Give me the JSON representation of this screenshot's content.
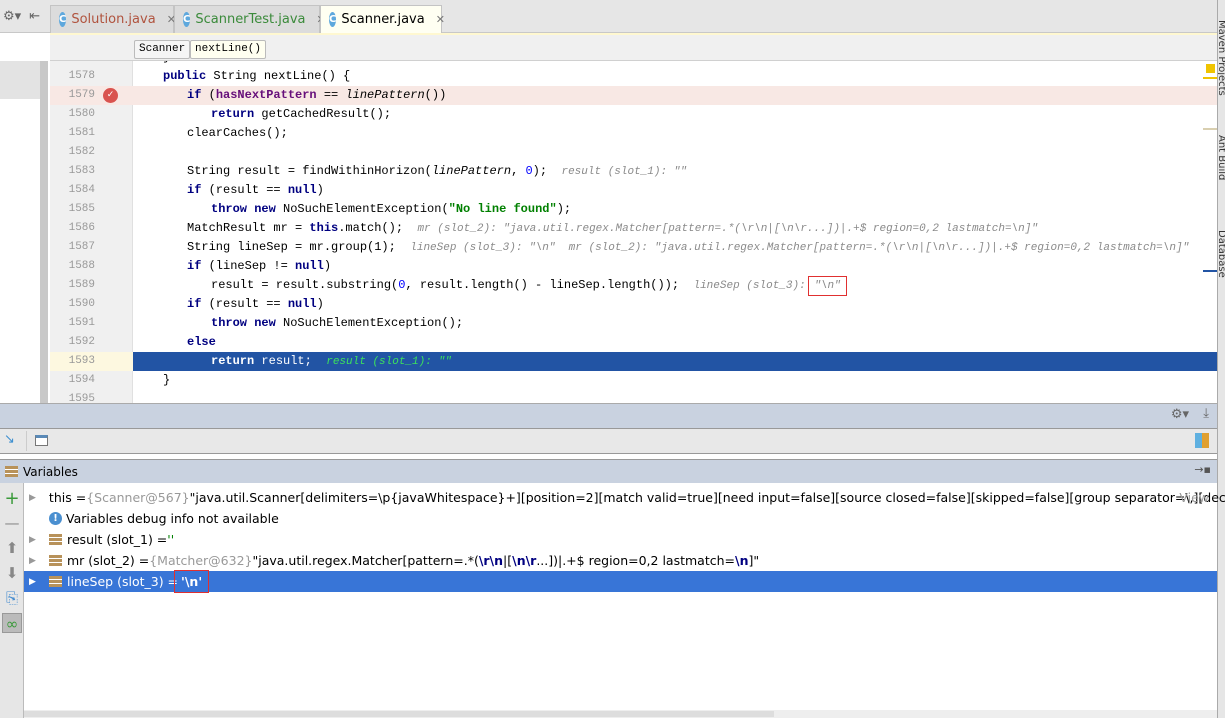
{
  "tabs": [
    {
      "label": "Solution.java",
      "color": "#b0533e",
      "active": false
    },
    {
      "label": "ScannerTest.java",
      "color": "#3a8a3a",
      "active": false
    },
    {
      "label": "Scanner.java",
      "color": "#000000",
      "active": true
    }
  ],
  "breadcrumbs": [
    "Scanner",
    "nextLine()"
  ],
  "editor": {
    "lines": [
      {
        "n": "1577",
        "indent": 1,
        "tokens": [
          {
            "t": "}",
            "c": ""
          }
        ]
      },
      {
        "n": "1578",
        "indent": 1,
        "tokens": [
          {
            "t": "public",
            "c": "kw"
          },
          {
            "t": " String nextLine() {",
            "c": ""
          }
        ]
      },
      {
        "n": "1579",
        "indent": 2,
        "state": "breakpoint",
        "tokens": [
          {
            "t": "if",
            "c": "kw"
          },
          {
            "t": " (",
            "c": ""
          },
          {
            "t": "hasNextPattern",
            "c": "fld"
          },
          {
            "t": " == ",
            "c": ""
          },
          {
            "t": "linePattern",
            "c": "it"
          },
          {
            "t": "())",
            "c": ""
          }
        ]
      },
      {
        "n": "1580",
        "indent": 3,
        "tokens": [
          {
            "t": "return",
            "c": "kw"
          },
          {
            "t": " getCachedResult();",
            "c": ""
          }
        ]
      },
      {
        "n": "1581",
        "indent": 2,
        "tokens": [
          {
            "t": "clearCaches();",
            "c": ""
          }
        ]
      },
      {
        "n": "1582",
        "indent": 2,
        "tokens": []
      },
      {
        "n": "1583",
        "indent": 2,
        "tokens": [
          {
            "t": "String result = findWithinHorizon(",
            "c": ""
          },
          {
            "t": "linePattern",
            "c": "it"
          },
          {
            "t": ", ",
            "c": ""
          },
          {
            "t": "0",
            "c": "numl"
          },
          {
            "t": ");  ",
            "c": ""
          },
          {
            "t": "result (slot_1): \"\"",
            "c": "hint"
          }
        ]
      },
      {
        "n": "1584",
        "indent": 2,
        "tokens": [
          {
            "t": "if",
            "c": "kw"
          },
          {
            "t": " (result == ",
            "c": ""
          },
          {
            "t": "null",
            "c": "kw"
          },
          {
            "t": ")",
            "c": ""
          }
        ]
      },
      {
        "n": "1585",
        "indent": 3,
        "tokens": [
          {
            "t": "throw",
            "c": "kw"
          },
          {
            "t": " ",
            "c": ""
          },
          {
            "t": "new",
            "c": "kw"
          },
          {
            "t": " NoSuchElementException(",
            "c": ""
          },
          {
            "t": "\"No line found\"",
            "c": "str"
          },
          {
            "t": ");",
            "c": ""
          }
        ]
      },
      {
        "n": "1586",
        "indent": 2,
        "tokens": [
          {
            "t": "MatchResult mr = ",
            "c": ""
          },
          {
            "t": "this",
            "c": "kw"
          },
          {
            "t": ".match();  ",
            "c": ""
          },
          {
            "t": "mr (slot_2): \"java.util.regex.Matcher[pattern=.*(\\r\\n|[\\n\\r...])|.+$ region=0,2 lastmatch=\\n]\"",
            "c": "hint"
          }
        ]
      },
      {
        "n": "1587",
        "indent": 2,
        "tokens": [
          {
            "t": "String lineSep = mr.group(1);  ",
            "c": ""
          },
          {
            "t": "lineSep (slot_3): \"\\n\"  mr (slot_2): \"java.util.regex.Matcher[pattern=.*(\\r\\n|[\\n\\r...])|.+$ region=0,2 lastmatch=\\n]\"",
            "c": "hint"
          }
        ]
      },
      {
        "n": "1588",
        "indent": 2,
        "tokens": [
          {
            "t": "if",
            "c": "kw"
          },
          {
            "t": " (lineSep != ",
            "c": ""
          },
          {
            "t": "null",
            "c": "kw"
          },
          {
            "t": ")",
            "c": ""
          }
        ]
      },
      {
        "n": "1589",
        "indent": 3,
        "tokens": [
          {
            "t": "result = result.substring(",
            "c": ""
          },
          {
            "t": "0",
            "c": "numl"
          },
          {
            "t": ", result.length() - lineSep.length());  ",
            "c": ""
          },
          {
            "t": "lineSep (slot_3): ",
            "c": "hint"
          },
          {
            "t": "\"\\n\"",
            "c": "hint boxed"
          }
        ]
      },
      {
        "n": "1590",
        "indent": 2,
        "tokens": [
          {
            "t": "if",
            "c": "kw"
          },
          {
            "t": " (result == ",
            "c": ""
          },
          {
            "t": "null",
            "c": "kw"
          },
          {
            "t": ")",
            "c": ""
          }
        ]
      },
      {
        "n": "1591",
        "indent": 3,
        "tokens": [
          {
            "t": "throw",
            "c": "kw"
          },
          {
            "t": " ",
            "c": ""
          },
          {
            "t": "new",
            "c": "kw"
          },
          {
            "t": " NoSuchElementException();",
            "c": ""
          }
        ]
      },
      {
        "n": "1592",
        "indent": 2,
        "tokens": [
          {
            "t": "else",
            "c": "kw"
          }
        ]
      },
      {
        "n": "1593",
        "indent": 3,
        "state": "current",
        "tokens": [
          {
            "t": "return",
            "c": "kw"
          },
          {
            "t": " result;  ",
            "c": ""
          },
          {
            "t": "result (slot_1): \"\"",
            "c": "hint"
          }
        ]
      },
      {
        "n": "1594",
        "indent": 1,
        "tokens": [
          {
            "t": "}",
            "c": ""
          }
        ]
      },
      {
        "n": "1595",
        "indent": 1,
        "tokens": []
      }
    ]
  },
  "right_tool_windows": [
    "Maven Projects",
    "Ant Build",
    "Database"
  ],
  "debug": {
    "variables_title": "Variables",
    "variables": [
      {
        "expandable": true,
        "segments": [
          {
            "t": "this = ",
            "c": ""
          },
          {
            "t": "{Scanner@567}",
            "c": "gray"
          },
          {
            "t": " \"java.util.Scanner[delimiters=\\p{javaWhitespace}+][position=2][match valid=true][need input=false][source closed=false][skipped=false][group separator=\\,][decimal se...",
            "c": ""
          }
        ],
        "link": "View"
      },
      {
        "expandable": false,
        "info": true,
        "segments": [
          {
            "t": "Variables debug info not available",
            "c": ""
          }
        ]
      },
      {
        "expandable": true,
        "segments": [
          {
            "t": "result (slot_1) = ",
            "c": ""
          },
          {
            "t": "''",
            "c": "green"
          }
        ]
      },
      {
        "expandable": true,
        "segments": [
          {
            "t": "mr (slot_2) = ",
            "c": ""
          },
          {
            "t": "{Matcher@632}",
            "c": "gray"
          },
          {
            "t": " \"java.util.regex.Matcher[pattern=.*(",
            "c": ""
          },
          {
            "t": "\\r\\n",
            "c": "bold"
          },
          {
            "t": "|[",
            "c": ""
          },
          {
            "t": "\\n\\r",
            "c": "bold"
          },
          {
            "t": "...])|.+$ region=0,2 lastmatch=",
            "c": ""
          },
          {
            "t": "\\n",
            "c": "bold"
          },
          {
            "t": "]\"",
            "c": ""
          }
        ]
      },
      {
        "expandable": true,
        "selected": true,
        "segments": [
          {
            "t": "lineSep (slot_3) = ",
            "c": ""
          },
          {
            "t": "'\\n'",
            "c": "boxed-var"
          }
        ]
      }
    ]
  }
}
